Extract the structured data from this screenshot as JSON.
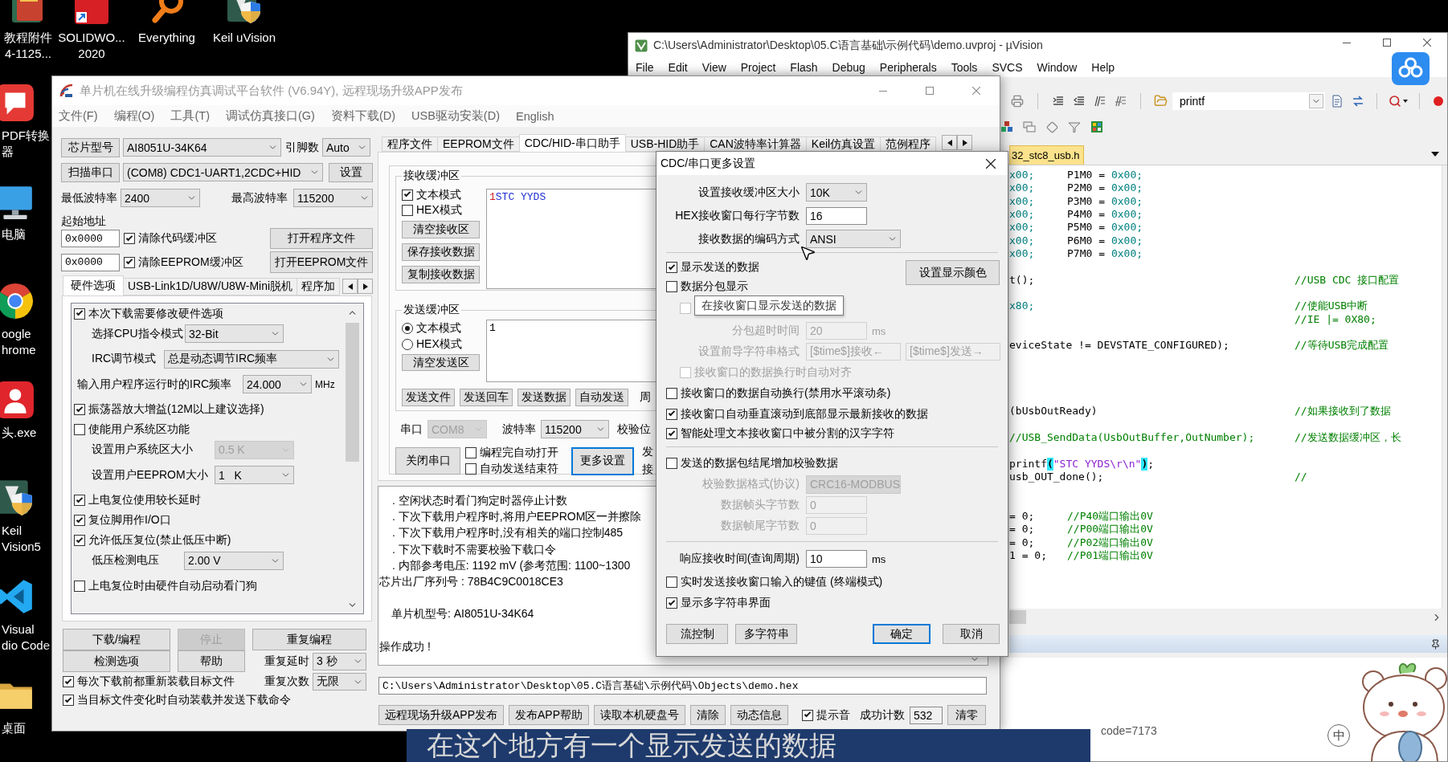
{
  "desktop": {
    "top_icons": [
      {
        "kind": "files",
        "lines": [
          "教程附件",
          "4-1125..."
        ]
      },
      {
        "kind": "tile",
        "lines": [
          "SOLIDWO...",
          "2020"
        ]
      },
      {
        "kind": "magnifier",
        "lines": [
          "Everything"
        ]
      },
      {
        "kind": "shield",
        "lines": [
          "Keil uVision"
        ]
      }
    ],
    "side_icons": [
      {
        "kind": "document",
        "lines": [
          "PDF转换",
          "器"
        ]
      },
      {
        "kind": "monitor",
        "lines": [
          "电脑"
        ]
      },
      {
        "kind": "ring",
        "lines": [
          "oogle",
          "hrome"
        ]
      },
      {
        "kind": "person",
        "lines": [
          "头.exe"
        ]
      },
      {
        "kind": "shield",
        "lines": [
          "Keil",
          "Vision5"
        ]
      },
      {
        "kind": "chevron",
        "lines": [
          "Visual",
          "dio Code"
        ]
      },
      {
        "kind": "folder",
        "lines": [
          "桌面"
        ]
      }
    ]
  },
  "uvision": {
    "title": "C:\\Users\\Administrator\\Desktop\\05.C语言基础\\示例代码\\demo.uvproj - µVision",
    "menu": [
      "File",
      "Edit",
      "View",
      "Project",
      "Flash",
      "Debug",
      "Peripherals",
      "Tools",
      "SVCS",
      "Window",
      "Help"
    ],
    "find_value": "printf",
    "file_tab": {
      "label": "32_stc8_usb.h",
      "selected": true
    },
    "code_lines": [
      {
        "kind": "aligned",
        "segments": [
          {
            "kind": "number",
            "text": "x00;"
          },
          {
            "kind": "code",
            "text": "P1M0 ="
          },
          {
            "kind": "number",
            "text": "0x00;"
          }
        ]
      },
      {
        "kind": "aligned",
        "segments": [
          {
            "kind": "number",
            "text": "x00;"
          },
          {
            "kind": "code",
            "text": "P2M0 ="
          },
          {
            "kind": "number",
            "text": "0x00;"
          }
        ]
      },
      {
        "kind": "aligned",
        "segments": [
          {
            "kind": "number",
            "text": "x00;"
          },
          {
            "kind": "code",
            "text": "P3M0 ="
          },
          {
            "kind": "number",
            "text": "0x00;"
          }
        ]
      },
      {
        "kind": "aligned",
        "segments": [
          {
            "kind": "number",
            "text": "x00;"
          },
          {
            "kind": "code",
            "text": "P4M0 ="
          },
          {
            "kind": "number",
            "text": "0x00;"
          }
        ]
      },
      {
        "kind": "aligned",
        "segments": [
          {
            "kind": "number",
            "text": "x00;"
          },
          {
            "kind": "code",
            "text": "P5M0 ="
          },
          {
            "kind": "number",
            "text": "0x00;"
          }
        ]
      },
      {
        "kind": "aligned",
        "segments": [
          {
            "kind": "number",
            "text": "x00;"
          },
          {
            "kind": "code",
            "text": "P6M0 ="
          },
          {
            "kind": "number",
            "text": "0x00;"
          }
        ]
      },
      {
        "kind": "aligned",
        "segments": [
          {
            "kind": "number",
            "text": "x00;"
          },
          {
            "kind": "code",
            "text": "P7M0 ="
          },
          {
            "kind": "number",
            "text": "0x00;"
          }
        ]
      },
      {
        "kind": "blank"
      },
      {
        "kind": "code",
        "segments": [
          {
            "kind": "code",
            "text": "t();"
          },
          {
            "kind": "comment",
            "text": "//USB CDC 接口配置"
          }
        ]
      },
      {
        "kind": "blank"
      },
      {
        "kind": "code",
        "segments": [
          {
            "kind": "number",
            "text": "x80;"
          },
          {
            "kind": "comment",
            "text": "//使能USB中断"
          }
        ]
      },
      {
        "kind": "code",
        "segments": [
          {
            "kind": "comment",
            "text": "//IE |= 0X80;"
          }
        ]
      },
      {
        "kind": "blank"
      },
      {
        "kind": "code",
        "segments": [
          {
            "kind": "code",
            "text": "eviceState != DEVSTATE_CONFIGURED);"
          },
          {
            "kind": "comment",
            "text": "//等待USB完成配置"
          }
        ]
      },
      {
        "kind": "blank"
      },
      {
        "kind": "blank"
      },
      {
        "kind": "blank"
      },
      {
        "kind": "blank"
      },
      {
        "kind": "code",
        "segments": [
          {
            "kind": "code",
            "text": "(bUsbOutReady)"
          },
          {
            "kind": "comment",
            "text": "//如果接收到了数据"
          }
        ]
      },
      {
        "kind": "blank"
      },
      {
        "kind": "code",
        "segments": [
          {
            "kind": "note",
            "text": "//USB_SendData(UsbOutBuffer,OutNumber);"
          },
          {
            "kind": "comment",
            "text": "//发送数据缓冲区，长"
          }
        ]
      },
      {
        "kind": "blank"
      },
      {
        "kind": "code",
        "segments": [
          {
            "kind": "code",
            "text": "printf"
          },
          {
            "kind": "brace",
            "text": "("
          },
          {
            "kind": "string",
            "text": "\"STC YYDS\\r\\n\""
          },
          {
            "kind": "brace",
            "text": ")"
          },
          {
            "kind": "code",
            "text": ";"
          }
        ]
      },
      {
        "kind": "code",
        "segments": [
          {
            "kind": "code",
            "text": "usb_OUT_done();"
          },
          {
            "kind": "comment",
            "text": "//"
          }
        ]
      },
      {
        "kind": "blank"
      },
      {
        "kind": "blank"
      },
      {
        "kind": "aligned",
        "segments": [
          {
            "kind": "code",
            "text": "= 0;"
          },
          {
            "kind": "note",
            "text": "//P40端口输出0V"
          }
        ]
      },
      {
        "kind": "aligned",
        "segments": [
          {
            "kind": "code",
            "text": "= 0;"
          },
          {
            "kind": "note",
            "text": "//P00端口输出0V"
          }
        ]
      },
      {
        "kind": "aligned",
        "segments": [
          {
            "kind": "code",
            "text": "= 0;"
          },
          {
            "kind": "note",
            "text": "//P02端口输出0V"
          }
        ]
      },
      {
        "kind": "aligned",
        "segments": [
          {
            "kind": "code",
            "text": "1 = 0;"
          },
          {
            "kind": "note",
            "text": "//P01端口输出0V"
          }
        ]
      }
    ],
    "output_text": "code=7173"
  },
  "stc": {
    "title": "单片机在线升级编程仿真调试平台软件 (V6.94Y), 远程现场升级APP发布",
    "menu": [
      "文件(F)",
      "编程(O)",
      "工具(T)",
      "调试仿真接口(G)",
      "资料下载(D)",
      "USB驱动安装(D)",
      "English"
    ],
    "chip": {
      "button": "芯片型号",
      "value": "AI8051U-34K64",
      "pins_label": "引脚数",
      "pins_value": "Auto"
    },
    "port": {
      "button": "扫描串口",
      "value": "(COM8) CDC1-UART1,2CDC+HID",
      "settings_button": "设置"
    },
    "baud": {
      "min_label": "最低波特率",
      "min_value": "2400",
      "max_label": "最高波特率",
      "max_value": "115200"
    },
    "start_address": {
      "label": "起始地址",
      "rows": [
        {
          "value": "0x0000",
          "option": "清除代码缓冲区",
          "checked": true,
          "button": "打开程序文件"
        },
        {
          "value": "0x0000",
          "option": "清除EEPROM缓冲区",
          "checked": true,
          "button": "打开EEPROM文件"
        }
      ]
    },
    "option_tabs": [
      {
        "label": "硬件选项",
        "selected": true
      },
      {
        "label": "USB-Link1D/U8W/U8W-Mini脱机",
        "selected": false
      },
      {
        "label": "程序加",
        "selected": false
      }
    ],
    "hardware_options": [
      {
        "kind": "check",
        "label": "本次下载需要修改硬件选项",
        "checked": true
      },
      {
        "kind": "select",
        "label": "选择CPU指令模式",
        "value": "32-Bit",
        "disabled": false
      },
      {
        "kind": "select",
        "label": "IRC调节模式",
        "value": "总是动态调节IRC频率",
        "disabled": false
      },
      {
        "kind": "select",
        "label": "输入用户程序运行时的IRC频率",
        "value": "24.000",
        "unit": "MHz",
        "disabled": false
      },
      {
        "kind": "check",
        "label": "振荡器放大增益(12M以上建议选择)",
        "checked": true
      },
      {
        "kind": "check",
        "label": "使能用户系统区功能",
        "checked": false
      },
      {
        "kind": "select",
        "label": "设置用户系统区大小",
        "value": "0.5 K",
        "disabled": true
      },
      {
        "kind": "select",
        "label": "设置用户EEPROM大小",
        "value": "1   K",
        "disabled": false
      },
      {
        "kind": "check",
        "label": "上电复位使用较长延时",
        "checked": true
      },
      {
        "kind": "check",
        "label": "复位脚用作I/O口",
        "checked": true
      },
      {
        "kind": "check",
        "label": "允许低压复位(禁止低压中断)",
        "checked": true
      },
      {
        "kind": "select",
        "label": "低压检测电压",
        "value": "2.00 V",
        "disabled": false
      },
      {
        "kind": "check",
        "label": "上电复位时由硬件自动启动看门狗",
        "checked": false
      }
    ],
    "actions": [
      {
        "label": "下载/编程",
        "disabled": false
      },
      {
        "label": "停止",
        "disabled": true
      },
      {
        "label": "重复编程",
        "disabled": false
      },
      {
        "label": "检测选项",
        "disabled": false
      },
      {
        "label": "帮助",
        "disabled": false
      }
    ],
    "repeat_delay": {
      "label": "重复延时",
      "value": "3 秒"
    },
    "repeat_count": {
      "label": "重复次数",
      "value": "无限"
    },
    "reload_options": [
      {
        "label": "每次下载前都重新装载目标文件",
        "checked": true
      },
      {
        "label": "当目标文件变化时自动装载并发送下载命令",
        "checked": true
      }
    ],
    "main_tabs": [
      {
        "label": "程序文件",
        "selected": false
      },
      {
        "label": "EEPROM文件",
        "selected": false
      },
      {
        "label": "CDC/HID-串口助手",
        "selected": true
      },
      {
        "label": "USB-HID助手",
        "selected": false
      },
      {
        "label": "CAN波特率计算器",
        "selected": false
      },
      {
        "label": "Keil仿真设置",
        "selected": false
      },
      {
        "label": "范例程序",
        "selected": false
      }
    ],
    "receive": {
      "title": "接收缓冲区",
      "modes": [
        {
          "label": "文本模式",
          "checked": true
        },
        {
          "label": "HEX模式",
          "checked": false
        }
      ],
      "buttons": [
        "清空接收区",
        "保存接收数据",
        "复制接收数据"
      ],
      "content": [
        {
          "kind": "sent",
          "text": "1"
        },
        {
          "kind": "received",
          "text": "STC YYDS"
        }
      ]
    },
    "send": {
      "title": "发送缓冲区",
      "modes": [
        {
          "label": "文本模式",
          "selected": true
        },
        {
          "label": "HEX模式",
          "selected": false
        }
      ],
      "clear_button": "清空发送区",
      "content": "1",
      "buttons": [
        "发送文件",
        "发送回车",
        "发送数据",
        "自动发送"
      ],
      "period_label": "周"
    },
    "serial": {
      "port": {
        "label": "串口",
        "value": "COM8",
        "disabled": true
      },
      "baud": {
        "label": "波特率",
        "value": "115200"
      },
      "parity_label": "校验位",
      "close_button": "关闭串口",
      "options": [
        {
          "label": "编程完自动打开",
          "checked": false
        },
        {
          "label": "自动发送结束符",
          "checked": false
        }
      ],
      "more_button": {
        "label": "更多设置",
        "focused": true
      },
      "side_labels": [
        "发",
        "接"
      ]
    },
    "log": [
      {
        "kind": "bullet",
        "text": ". 空闲状态时看门狗定时器停止计数"
      },
      {
        "kind": "bullet",
        "text": ". 下次下载用户程序时,将用户EEPROM区一并擦除"
      },
      {
        "kind": "bullet",
        "text": ". 下次下载用户程序时,没有相关的端口控制485"
      },
      {
        "kind": "bullet",
        "text": ". 下次下载时不需要校验下载口令"
      },
      {
        "kind": "bullet",
        "text": ". 内部参考电压: 1192 mV (参考范围: 1100~1300"
      },
      {
        "kind": "plain",
        "text": "芯片出厂序列号 : 78B4C9C0018CE3"
      },
      {
        "kind": "blank"
      },
      {
        "kind": "indented",
        "text": "单片机型号: AI8051U-34K64"
      },
      {
        "kind": "blank"
      },
      {
        "kind": "plain",
        "text": "操作成功 !"
      }
    ],
    "hex_path": "C:\\Users\\Administrator\\Desktop\\05.C语言基础\\示例代码\\Objects\\demo.hex",
    "footer": {
      "buttons": [
        "远程现场升级APP发布",
        "发布APP帮助",
        "读取本机硬盘号",
        "清除",
        "动态信息"
      ],
      "sound": {
        "label": "提示音",
        "checked": true
      },
      "count_label": "成功计数",
      "count_value": "532",
      "reset_button": "清零"
    }
  },
  "dialog": {
    "title": "CDC/串口更多设置",
    "fields": [
      {
        "label": "设置接收缓冲区大小",
        "value": "10K",
        "kind": "select"
      },
      {
        "label": "HEX接收窗口每行字节数",
        "value": "16",
        "kind": "input"
      },
      {
        "label": "接收数据的编码方式",
        "value": "ANSI",
        "kind": "select"
      }
    ],
    "show_sent": {
      "label": "显示发送的数据",
      "checked": true
    },
    "color_button": "设置显示颜色",
    "split": {
      "label": "数据分包显示",
      "checked": false
    },
    "hidden_option": {
      "checked": false,
      "disabled": true
    },
    "tooltip": "在接收窗口显示发送的数据",
    "timeout": {
      "label": "分包超时时间",
      "value": "20",
      "unit": "ms",
      "disabled": true
    },
    "prefix": {
      "label": "设置前导字符串格式",
      "receive": "[$time$]接收←",
      "send": "[$time$]发送→",
      "disabled": true
    },
    "align": {
      "label": "接收窗口的数据换行时自动对齐",
      "checked": false,
      "disabled": true
    },
    "display_options": [
      {
        "label": "接收窗口的数据自动换行(禁用水平滚动条)",
        "checked": false
      },
      {
        "label": "接收窗口自动垂直滚动到底部显示最新接收的数据",
        "checked": true
      },
      {
        "label": "智能处理文本接收窗口中被分割的汉字字符",
        "checked": true
      }
    ],
    "checksum": {
      "label": "发送的数据包结尾增加校验数据",
      "checked": false
    },
    "checksum_fields": [
      {
        "label": "校验数据格式(协议)",
        "value": "CRC16-MODBUS",
        "kind": "select",
        "disabled": true
      },
      {
        "label": "数据帧头字节数",
        "value": "0",
        "kind": "input",
        "disabled": true
      },
      {
        "label": "数据帧尾字节数",
        "value": "0",
        "kind": "input",
        "disabled": true
      }
    ],
    "response": {
      "label": "响应接收时间(查询周期)",
      "value": "10",
      "unit": "ms"
    },
    "bottom_options": [
      {
        "label": "实时发送接收窗口输入的键值 (终端模式)",
        "checked": false
      },
      {
        "label": "显示多字符串界面",
        "checked": true
      }
    ],
    "buttons": [
      {
        "label": "流控制",
        "default": false
      },
      {
        "label": "多字符串",
        "default": false
      },
      {
        "label": "确定",
        "default": true
      },
      {
        "label": "取消",
        "default": false
      }
    ]
  },
  "ime_label": "中",
  "subtitle": "在这个地方有一个显示发送的数据"
}
